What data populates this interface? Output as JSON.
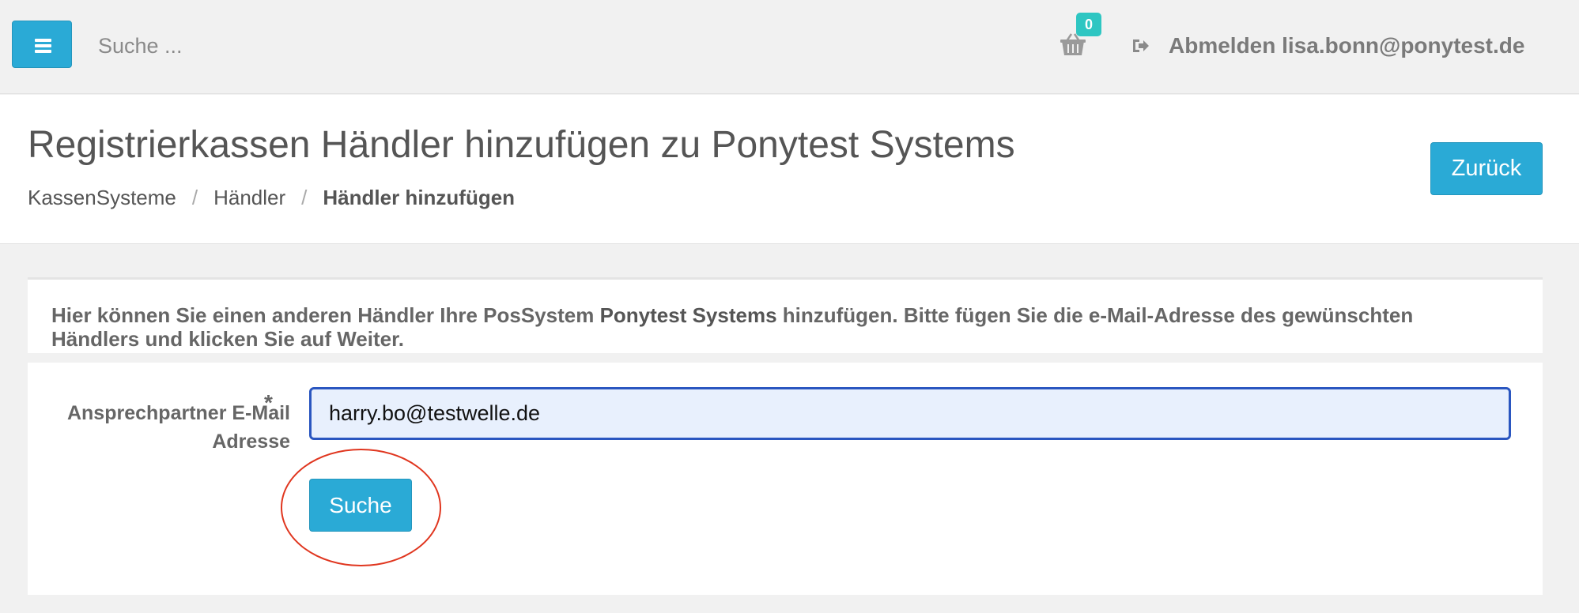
{
  "topbar": {
    "search_placeholder": "Suche ...",
    "cart_count": "0",
    "logout_label": "Abmelden lisa.bonn@ponytest.de"
  },
  "header": {
    "title": "Registrierkassen Händler hinzufügen zu Ponytest Systems",
    "breadcrumb": {
      "item1": "KassenSysteme",
      "item2": "Händler",
      "current": "Händler hinzufügen",
      "separator": "/"
    },
    "back_label": "Zurück"
  },
  "info": {
    "text_before": "Hier können Sie einen anderen Händler Ihre PosSystem ",
    "system_name": "Ponytest Systems",
    "text_after": " hinzufügen. Bitte fügen Sie die e-Mail-Adresse des gewünschten Händlers und klicken Sie auf Weiter."
  },
  "form": {
    "email_label": "Ansprechpartner E-Mail Adresse",
    "required_mark": "*",
    "email_value": "harry.bo@testwelle.de",
    "search_label": "Suche"
  },
  "colors": {
    "accent": "#2aaad6",
    "badge": "#2ec6c2",
    "input_focus": "#2a56c0",
    "annotation": "#e0361f"
  }
}
